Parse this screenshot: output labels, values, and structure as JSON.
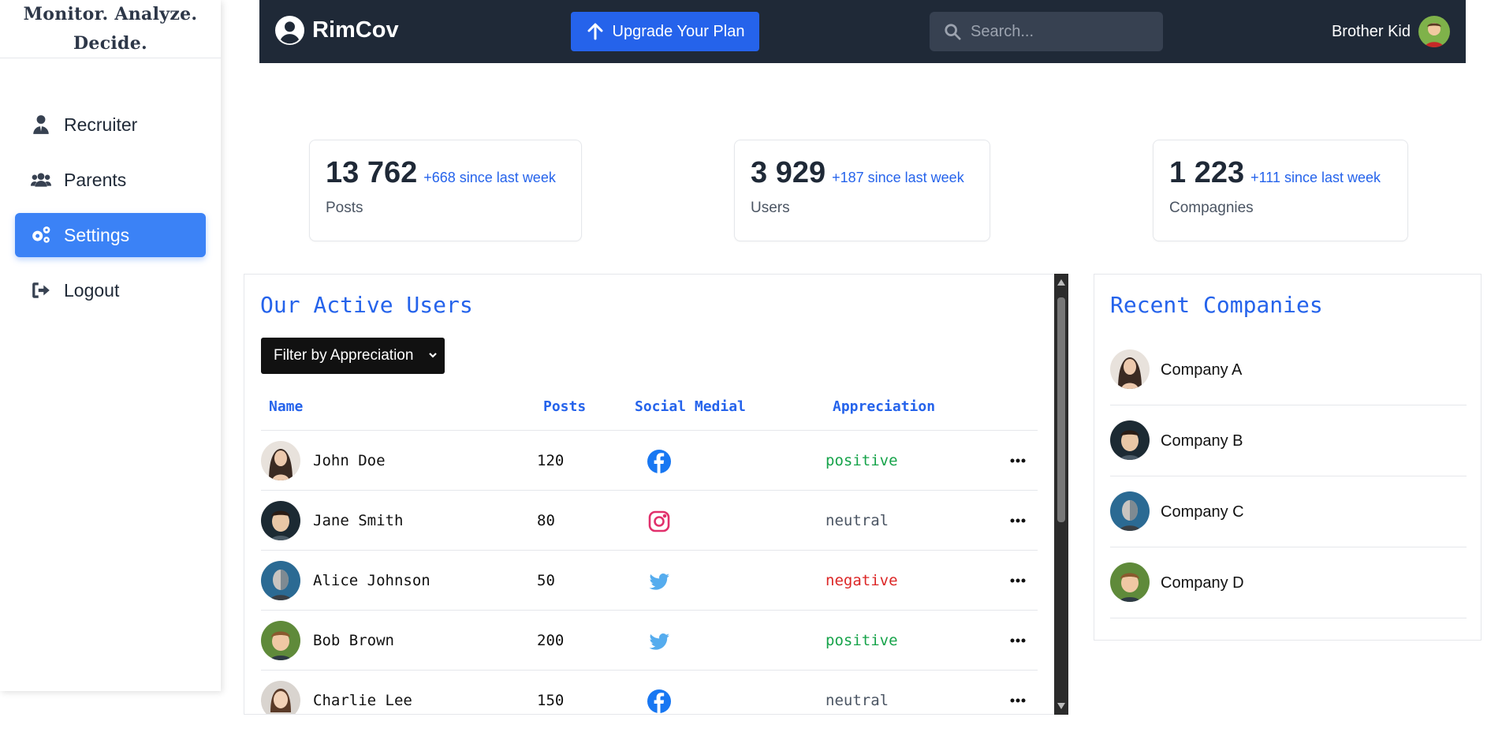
{
  "sidebar": {
    "tagline_line1": "Monitor. Analyze.",
    "tagline_line2": "Decide.",
    "items": [
      {
        "label": "Recruiter",
        "icon": "user-tie-icon"
      },
      {
        "label": "Parents",
        "icon": "users-icon"
      },
      {
        "label": "Settings",
        "icon": "gears-icon",
        "active": true
      },
      {
        "label": "Logout",
        "icon": "logout-icon"
      }
    ]
  },
  "header": {
    "brand": "RimCov",
    "upgrade_label": "Upgrade Your Plan",
    "search_placeholder": "Search...",
    "user_name": "Brother Kid"
  },
  "stats": [
    {
      "value": "13 762",
      "delta": "+668 since last week",
      "label": "Posts"
    },
    {
      "value": "3 929",
      "delta": "+187 since last week",
      "label": "Users"
    },
    {
      "value": "1 223",
      "delta": "+111 since last week",
      "label": "Compagnies"
    }
  ],
  "active_users": {
    "title": "Our Active Users",
    "filter_label": "Filter by Appreciation",
    "columns": {
      "name": "Name",
      "posts": "Posts",
      "social": "Social Medial",
      "appreciation": "Appreciation"
    },
    "rows": [
      {
        "name": "John Doe",
        "posts": "120",
        "social": "facebook",
        "appreciation": "positive"
      },
      {
        "name": "Jane Smith",
        "posts": "80",
        "social": "instagram",
        "appreciation": "neutral"
      },
      {
        "name": "Alice Johnson",
        "posts": "50",
        "social": "twitter",
        "appreciation": "negative"
      },
      {
        "name": "Bob Brown",
        "posts": "200",
        "social": "twitter",
        "appreciation": "positive"
      },
      {
        "name": "Charlie Lee",
        "posts": "150",
        "social": "facebook",
        "appreciation": "neutral"
      }
    ]
  },
  "recent_companies": {
    "title": "Recent Companies",
    "items": [
      "Company A",
      "Company B",
      "Company C",
      "Company D"
    ]
  },
  "colors": {
    "accent": "#3b82f6",
    "header_bg": "#1f2937",
    "positive": "#16a34a",
    "negative": "#dc2626",
    "neutral": "#4b5563"
  }
}
